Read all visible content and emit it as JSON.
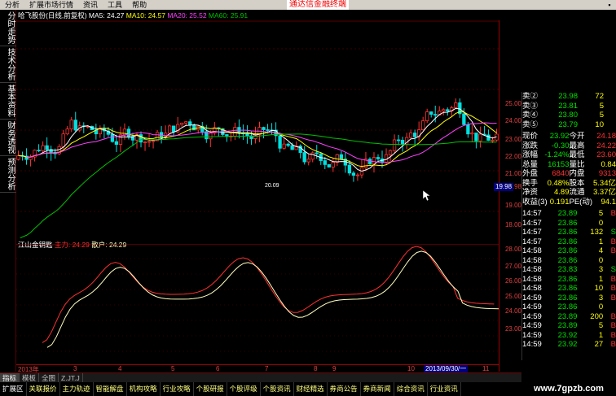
{
  "menu": {
    "items": [
      "分析",
      "扩展市场行情",
      "资讯",
      "工具",
      "帮助"
    ],
    "ad_text": "通达信金融终端"
  },
  "vtabs": [
    "分时走势",
    "技术分析",
    "基本资料",
    "财务透视",
    "预测分析"
  ],
  "stock_line": {
    "name": "哈飞股份(日线,前复权)",
    "ma5_label": "MA5: 24.27",
    "ma10_label": "MA10: 24.57",
    "ma20_label": "MA20: 25.52",
    "ma60_label": "MA60: 25.91"
  },
  "indicator_line": {
    "name": "江山金钥匙",
    "main_label": "主力: 24.29",
    "retail_label": "散户: 24.29"
  },
  "main_axis_ticks": [
    "25.00",
    "24.00",
    "23.00",
    "22.00",
    "21.00",
    "19.98",
    "19.00",
    "18.00"
  ],
  "sub_axis_ticks": [
    "28.00",
    "27.00",
    "26.00",
    "25.00",
    "24.00",
    "23.00"
  ],
  "price_tag": "19.98",
  "low_label": "20.09",
  "date_axis": [
    "2013年",
    "3",
    "4",
    "5",
    "6",
    "7",
    "8",
    "9",
    "10",
    "11"
  ],
  "date_box": "2013/09/30/一",
  "quote": {
    "asks": [
      {
        "label": "卖②",
        "price": "23.98",
        "vol": "72"
      },
      {
        "label": "卖③",
        "price": "23.81",
        "vol": "5"
      },
      {
        "label": "卖④",
        "price": "23.80",
        "vol": "5"
      },
      {
        "label": "卖⑤",
        "price": "23.79",
        "vol": "10"
      }
    ],
    "stats": [
      {
        "l1": "现价",
        "v1": "23.92",
        "l2": "今开",
        "v2": "24.18"
      },
      {
        "l1": "涨跌",
        "v1": "-0.30",
        "l2": "最高",
        "v2": "24.22"
      },
      {
        "l1": "涨幅",
        "v1": "-1.24%",
        "l2": "最低",
        "v2": "23.60"
      },
      {
        "l1": "总量",
        "v1": "16153",
        "l2": "量比",
        "v2": "0.84"
      },
      {
        "l1": "外盘",
        "v1": "6840",
        "l2": "内盘",
        "v2": "9313"
      }
    ],
    "stats2": [
      {
        "l1": "换手",
        "v1": "0.48%",
        "l2": "股本",
        "v2": "5.34亿"
      },
      {
        "l1": "净资",
        "v1": "4.89",
        "l2": "流通",
        "v2": "3.37亿"
      },
      {
        "l1": "收益(3)",
        "v1": "0.191",
        "l2": "PE(动)",
        "v2": "94.1"
      }
    ],
    "ticks": [
      {
        "t": "14:57",
        "p": "23.89",
        "v": "5",
        "d": "B"
      },
      {
        "t": "14:57",
        "p": "23.86",
        "v": "0",
        "d": ""
      },
      {
        "t": "14:57",
        "p": "23.86",
        "v": "132",
        "d": "S"
      },
      {
        "t": "14:57",
        "p": "23.86",
        "v": "1",
        "d": "B"
      },
      {
        "t": "14:58",
        "p": "23.86",
        "v": "4",
        "d": "B"
      },
      {
        "t": "14:58",
        "p": "23.86",
        "v": "0",
        "d": ""
      },
      {
        "t": "14:58",
        "p": "23.83",
        "v": "3",
        "d": "S"
      },
      {
        "t": "14:58",
        "p": "23.86",
        "v": "1",
        "d": "B"
      },
      {
        "t": "14:58",
        "p": "23.86",
        "v": "10",
        "d": "B"
      },
      {
        "t": "14:59",
        "p": "23.86",
        "v": "3",
        "d": "B"
      },
      {
        "t": "14:59",
        "p": "23.86",
        "v": "0",
        "d": ""
      },
      {
        "t": "14:59",
        "p": "23.89",
        "v": "200",
        "d": "B"
      },
      {
        "t": "14:59",
        "p": "23.89",
        "v": "5",
        "d": "B"
      },
      {
        "t": "14:59",
        "p": "23.92",
        "v": "1",
        "d": "B"
      },
      {
        "t": "14:59",
        "p": "23.92",
        "v": "27",
        "d": "B"
      }
    ]
  },
  "bottom_tabs": [
    "指标",
    "模板",
    "全图",
    "Z.JT.J"
  ],
  "status_tabs": [
    "扩展区",
    "关联报价",
    "主力轨迹",
    "智能解盘",
    "机构攻略",
    "行业攻略",
    "个股研报",
    "个股评级",
    "个股资讯",
    "财经精选",
    "券商公告",
    "券商新闻",
    "综合资讯",
    "行业资讯"
  ],
  "watermark": "www.7gpzb.com",
  "colors": {
    "up": "#ff3030",
    "down": "#00e0e0",
    "ma5": "#ffffff",
    "ma10": "#ffff00",
    "ma20": "#ff40ff",
    "ma60": "#00c000",
    "main_line": "#ff3030",
    "retail_line": "#ffffc0"
  }
}
